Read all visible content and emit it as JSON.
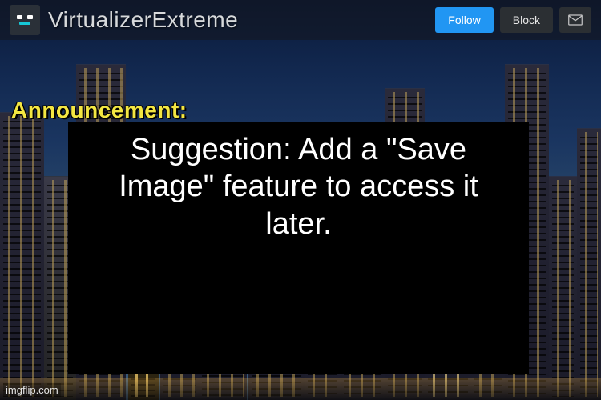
{
  "header": {
    "username": "VirtualizerExtreme",
    "follow_label": "Follow",
    "block_label": "Block"
  },
  "announcement": {
    "label": "Announcement:",
    "text": "Suggestion: Add a \"Save Image\" feature to access it later."
  },
  "watermark": "imgflip.com",
  "colors": {
    "follow_button": "#2196f3",
    "announcement_label": "#f3e642"
  }
}
